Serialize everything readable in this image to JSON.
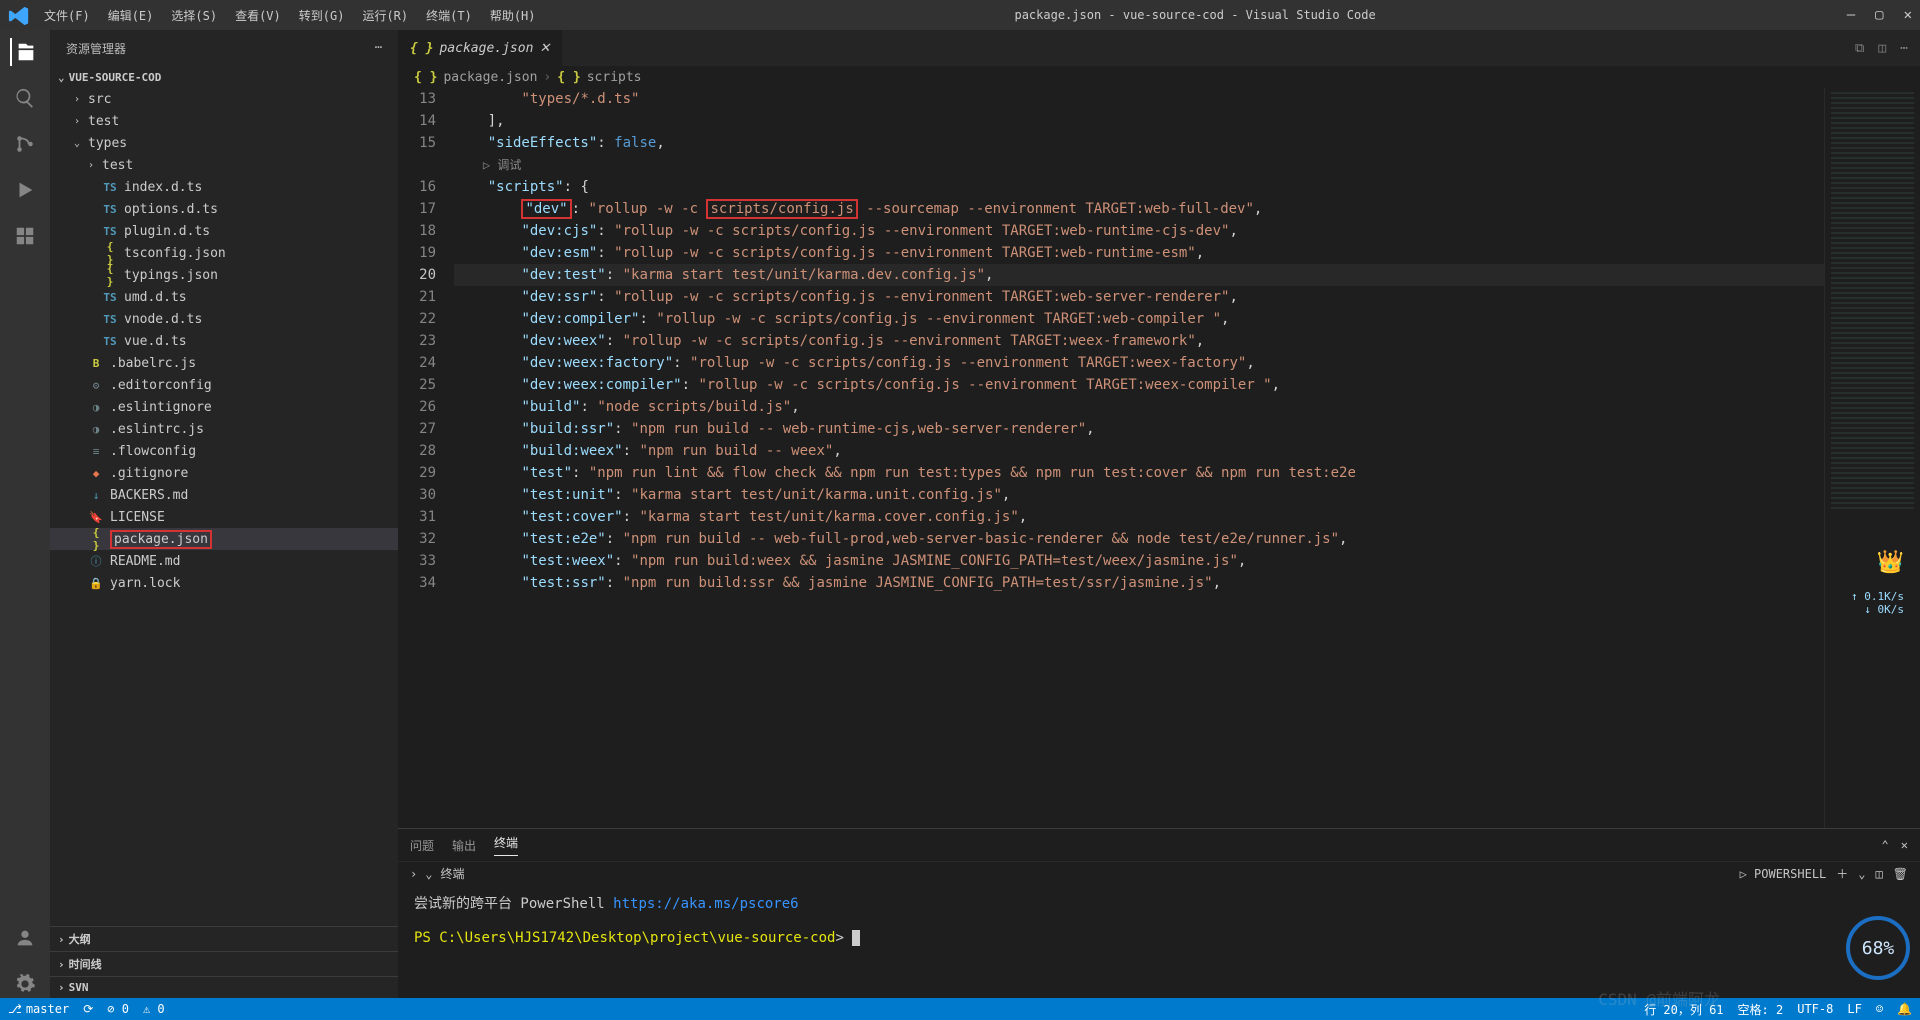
{
  "title": "package.json - vue-source-cod - Visual Studio Code",
  "menu": [
    "文件(F)",
    "编辑(E)",
    "选择(S)",
    "查看(V)",
    "转到(G)",
    "运行(R)",
    "终端(T)",
    "帮助(H)"
  ],
  "sidebar": {
    "title": "资源管理器",
    "project": "VUE-SOURCE-COD",
    "collapsibles": [
      "大纲",
      "时间线",
      "SVN"
    ],
    "tree": [
      {
        "indent": 1,
        "chev": "›",
        "type": "folder",
        "name": "src"
      },
      {
        "indent": 1,
        "chev": "›",
        "type": "folder",
        "name": "test"
      },
      {
        "indent": 1,
        "chev": "⌄",
        "type": "folder",
        "name": "types"
      },
      {
        "indent": 2,
        "chev": "›",
        "type": "folder",
        "name": "test"
      },
      {
        "indent": 2,
        "icon": "TS",
        "cls": "ts",
        "name": "index.d.ts"
      },
      {
        "indent": 2,
        "icon": "TS",
        "cls": "ts",
        "name": "options.d.ts"
      },
      {
        "indent": 2,
        "icon": "TS",
        "cls": "ts",
        "name": "plugin.d.ts"
      },
      {
        "indent": 2,
        "icon": "{ }",
        "cls": "json",
        "name": "tsconfig.json"
      },
      {
        "indent": 2,
        "icon": "{ }",
        "cls": "json",
        "name": "typings.json"
      },
      {
        "indent": 2,
        "icon": "TS",
        "cls": "ts",
        "name": "umd.d.ts"
      },
      {
        "indent": 2,
        "icon": "TS",
        "cls": "ts",
        "name": "vnode.d.ts"
      },
      {
        "indent": 2,
        "icon": "TS",
        "cls": "ts",
        "name": "vue.d.ts"
      },
      {
        "indent": 1,
        "icon": "B",
        "cls": "js",
        "name": ".babelrc.js"
      },
      {
        "indent": 1,
        "icon": "⚙",
        "cls": "gear",
        "name": ".editorconfig"
      },
      {
        "indent": 1,
        "icon": "◑",
        "cls": "gear",
        "name": ".eslintignore"
      },
      {
        "indent": 1,
        "icon": "◑",
        "cls": "gear",
        "name": ".eslintrc.js"
      },
      {
        "indent": 1,
        "icon": "≡",
        "cls": "gear",
        "name": ".flowconfig"
      },
      {
        "indent": 1,
        "icon": "◆",
        "cls": "git",
        "name": ".gitignore"
      },
      {
        "indent": 1,
        "icon": "↓",
        "cls": "md",
        "name": "BACKERS.md"
      },
      {
        "indent": 1,
        "icon": "🔖",
        "cls": "lic",
        "name": "LICENSE"
      },
      {
        "indent": 1,
        "icon": "{ }",
        "cls": "json",
        "name": "package.json",
        "selected": true,
        "boxed": true
      },
      {
        "indent": 1,
        "icon": "ⓘ",
        "cls": "md",
        "name": "README.md"
      },
      {
        "indent": 1,
        "icon": "🔒",
        "cls": "lock",
        "name": "yarn.lock"
      }
    ]
  },
  "tab": {
    "icon": "{ }",
    "label": "package.json"
  },
  "breadcrumbs": {
    "file": "package.json",
    "section": "scripts"
  },
  "debug_label": "▷ 调试",
  "code": [
    {
      "n": 13,
      "pre": "        ",
      "s": "\"types/*.d.ts\""
    },
    {
      "n": 14,
      "pre": "    ",
      "raw": "],"
    },
    {
      "n": 15,
      "pre": "    ",
      "k": "\"sideEffects\"",
      "col": ": ",
      "b": "false",
      "tail": ","
    },
    {
      "n": 16,
      "pre": "    ",
      "k": "\"scripts\"",
      "col": ": ",
      "tail": "{"
    },
    {
      "n": 17,
      "pre": "        ",
      "k": "\"dev\"",
      "boxk": true,
      "col": ": ",
      "s": "\"rollup -w -c ",
      "boxmid": "scripts/config.js",
      "s2": " --sourcemap --environment TARGET:web-full-dev\"",
      "tail": ","
    },
    {
      "n": 18,
      "pre": "        ",
      "k": "\"dev:cjs\"",
      "col": ": ",
      "s": "\"rollup -w -c scripts/config.js --environment TARGET:web-runtime-cjs-dev\"",
      "tail": ","
    },
    {
      "n": 19,
      "pre": "        ",
      "k": "\"dev:esm\"",
      "col": ": ",
      "s": "\"rollup -w -c scripts/config.js --environment TARGET:web-runtime-esm\"",
      "tail": ","
    },
    {
      "n": 20,
      "pre": "        ",
      "k": "\"dev:test\"",
      "col": ": ",
      "s": "\"karma start test/unit/karma.dev.config.js\"",
      "tail": ",",
      "cur": true
    },
    {
      "n": 21,
      "pre": "        ",
      "k": "\"dev:ssr\"",
      "col": ": ",
      "s": "\"rollup -w -c scripts/config.js --environment TARGET:web-server-renderer\"",
      "tail": ","
    },
    {
      "n": 22,
      "pre": "        ",
      "k": "\"dev:compiler\"",
      "col": ": ",
      "s": "\"rollup -w -c scripts/config.js --environment TARGET:web-compiler \"",
      "tail": ","
    },
    {
      "n": 23,
      "pre": "        ",
      "k": "\"dev:weex\"",
      "col": ": ",
      "s": "\"rollup -w -c scripts/config.js --environment TARGET:weex-framework\"",
      "tail": ","
    },
    {
      "n": 24,
      "pre": "        ",
      "k": "\"dev:weex:factory\"",
      "col": ": ",
      "s": "\"rollup -w -c scripts/config.js --environment TARGET:weex-factory\"",
      "tail": ","
    },
    {
      "n": 25,
      "pre": "        ",
      "k": "\"dev:weex:compiler\"",
      "col": ": ",
      "s": "\"rollup -w -c scripts/config.js --environment TARGET:weex-compiler \"",
      "tail": ","
    },
    {
      "n": 26,
      "pre": "        ",
      "k": "\"build\"",
      "col": ": ",
      "s": "\"node scripts/build.js\"",
      "tail": ","
    },
    {
      "n": 27,
      "pre": "        ",
      "k": "\"build:ssr\"",
      "col": ": ",
      "s": "\"npm run build -- web-runtime-cjs,web-server-renderer\"",
      "tail": ","
    },
    {
      "n": 28,
      "pre": "        ",
      "k": "\"build:weex\"",
      "col": ": ",
      "s": "\"npm run build -- weex\"",
      "tail": ","
    },
    {
      "n": 29,
      "pre": "        ",
      "k": "\"test\"",
      "col": ": ",
      "s": "\"npm run lint && flow check && npm run test:types && npm run test:cover && npm run test:e2e",
      "tail": ""
    },
    {
      "n": 30,
      "pre": "        ",
      "k": "\"test:unit\"",
      "col": ": ",
      "s": "\"karma start test/unit/karma.unit.config.js\"",
      "tail": ","
    },
    {
      "n": 31,
      "pre": "        ",
      "k": "\"test:cover\"",
      "col": ": ",
      "s": "\"karma start test/unit/karma.cover.config.js\"",
      "tail": ","
    },
    {
      "n": 32,
      "pre": "        ",
      "k": "\"test:e2e\"",
      "col": ": ",
      "s": "\"npm run build -- web-full-prod,web-server-basic-renderer && node test/e2e/runner.js\"",
      "tail": ","
    },
    {
      "n": 33,
      "pre": "        ",
      "k": "\"test:weex\"",
      "col": ": ",
      "s": "\"npm run build:weex && jasmine JASMINE_CONFIG_PATH=test/weex/jasmine.js\"",
      "tail": ","
    },
    {
      "n": 34,
      "pre": "        ",
      "k": "\"test:ssr\"",
      "col": ": ",
      "s": "\"npm run build:ssr && jasmine JASMINE_CONFIG_PATH=test/ssr/jasmine.js\"",
      "tail": ","
    }
  ],
  "panel": {
    "tabs": [
      "问题",
      "输出",
      "终端"
    ],
    "active": "终端",
    "shell": "POWERSHELL",
    "sub": "终端",
    "line1_pre": "尝试新的跨平台 PowerShell ",
    "line1_link": "https://aka.ms/pscore6",
    "prompt_ps": "PS ",
    "prompt_path": "C:\\Users\\HJS1742\\Desktop\\project\\vue-source-cod",
    "prompt_tail": "> "
  },
  "status": {
    "branch": "master",
    "sync": "⟳",
    "errors": "⊘ 0",
    "warnings": "⚠ 0",
    "cursor": "行 20，列 61",
    "spaces": "空格: 2",
    "encoding": "UTF-8",
    "eol": "LF",
    "watermark": "CSDN @前端阿龙"
  },
  "overlay": {
    "net_up": "↑ 0.1K/s",
    "net_dn": "↓ 0K/s",
    "crown": "👑",
    "percent": "68%"
  }
}
